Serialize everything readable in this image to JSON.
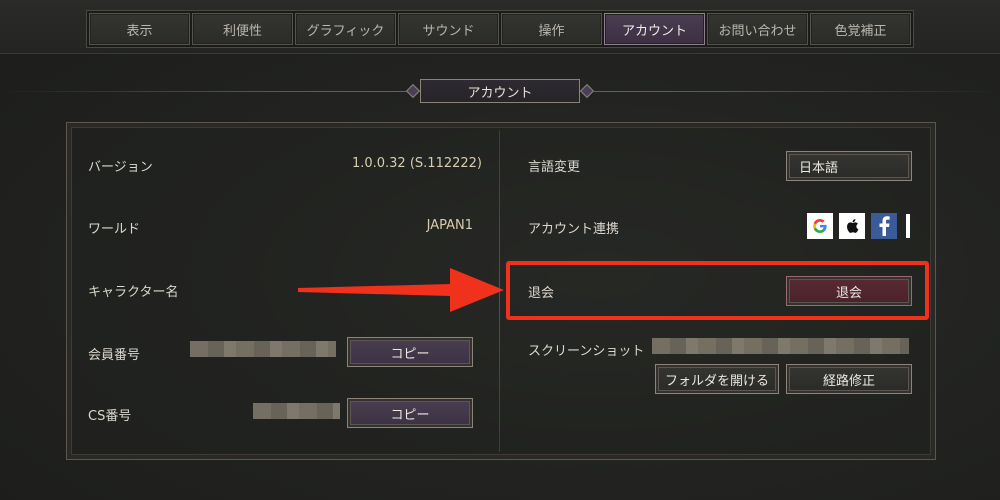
{
  "tabs": [
    "表示",
    "利便性",
    "グラフィック",
    "サウンド",
    "操作",
    "アカウント",
    "お問い合わせ",
    "色覚補正"
  ],
  "active_tab": "アカウント",
  "section_title": "アカウント",
  "left": {
    "version_label": "バージョン",
    "version_value": "1.0.0.32 (S.112222)",
    "world_label": "ワールド",
    "world_value": "JAPAN1",
    "character_label": "キャラクター名",
    "member_label": "会員番号",
    "member_copy": "コピー",
    "cs_label": "CS番号",
    "cs_copy": "コピー"
  },
  "right": {
    "language_label": "言語変更",
    "language_value": "日本語",
    "link_label": "アカウント連携",
    "withdraw_label": "退会",
    "withdraw_button": "退会",
    "screenshot_label": "スクリーンショット",
    "open_folder": "フォルダを開ける",
    "fix_path": "経路修正"
  },
  "social_icons": [
    "google-icon",
    "apple-icon",
    "facebook-icon"
  ],
  "annotation": {
    "color": "#f0311c"
  },
  "colors": {
    "active_tab": "#3c3042",
    "purple_button": "#3a3142",
    "red_button": "#47222a"
  }
}
